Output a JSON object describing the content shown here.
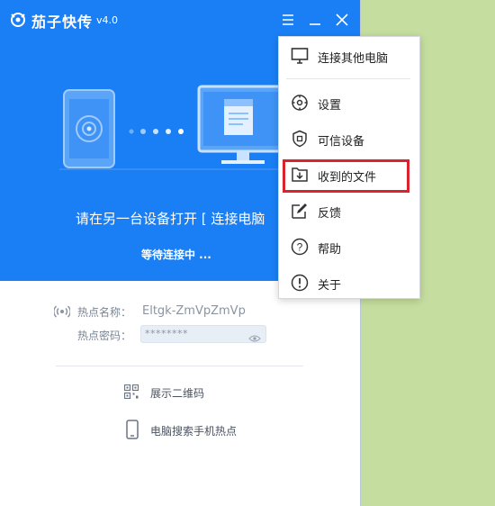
{
  "app": {
    "name": "茄子快传",
    "version": "v4.0"
  },
  "hero": {
    "connect_prompt": "请在另一台设备打开 [ 连接电脑",
    "waiting": "等待连接中 ..."
  },
  "hotspot": {
    "name_label": "热点名称：",
    "name_value": "Eltgk-ZmVpZmVp",
    "password_label": "热点密码：",
    "password_value": "********"
  },
  "actions": {
    "show_qr": "展示二维码",
    "pc_search_hotspot": "电脑搜索手机热点"
  },
  "menu": {
    "items": [
      {
        "label": "连接其他电脑",
        "icon": "monitor-icon"
      },
      {
        "label": "设置",
        "icon": "settings-icon"
      },
      {
        "label": "可信设备",
        "icon": "shield-icon"
      },
      {
        "label": "收到的文件",
        "icon": "download-folder-icon"
      },
      {
        "label": "反馈",
        "icon": "edit-icon"
      },
      {
        "label": "帮助",
        "icon": "help-icon"
      },
      {
        "label": "关于",
        "icon": "info-icon"
      }
    ]
  },
  "colors": {
    "brand_blue": "#1a7ff5",
    "highlight_red": "#d9232d",
    "desktop_green": "#c5dd9f"
  }
}
